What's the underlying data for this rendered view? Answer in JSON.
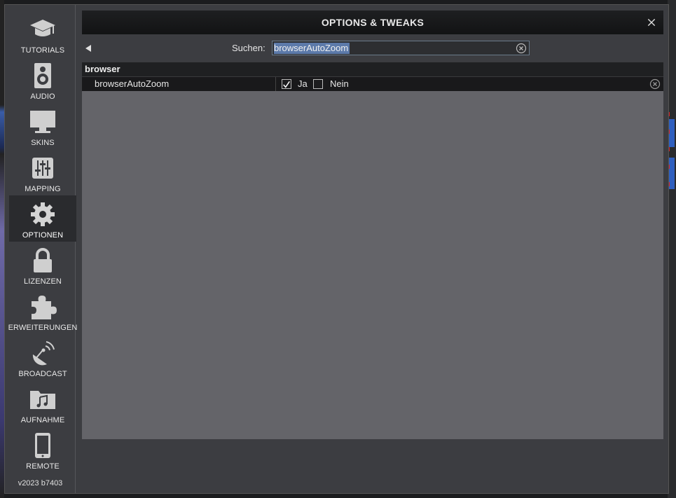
{
  "dialog": {
    "title": "OPTIONS & TWEAKS",
    "version": "v2023 b7403"
  },
  "sidebar": {
    "items": [
      {
        "label": "TUTORIALS",
        "icon": "graduation-cap-icon",
        "active": false
      },
      {
        "label": "AUDIO",
        "icon": "speaker-icon",
        "active": false
      },
      {
        "label": "SKINS",
        "icon": "monitor-icon",
        "active": false
      },
      {
        "label": "MAPPING",
        "icon": "sliders-icon",
        "active": false
      },
      {
        "label": "OPTIONEN",
        "icon": "gear-icon",
        "active": true
      },
      {
        "label": "LIZENZEN",
        "icon": "lock-icon",
        "active": false
      },
      {
        "label": "ERWEITERUNGEN",
        "icon": "puzzle-icon",
        "active": false
      },
      {
        "label": "BROADCAST",
        "icon": "satellite-dish-icon",
        "active": false
      },
      {
        "label": "AUFNAHME",
        "icon": "music-folder-icon",
        "active": false
      },
      {
        "label": "REMOTE",
        "icon": "tablet-icon",
        "active": false
      }
    ]
  },
  "search": {
    "label": "Suchen:",
    "value": "browserAutoZoom"
  },
  "options": {
    "group": "browser",
    "row": {
      "name": "browserAutoZoom",
      "yes_label": "Ja",
      "no_label": "Nein",
      "yes_checked": true,
      "no_checked": false
    }
  },
  "colors": {
    "accent_selection": "#5c7aaa",
    "panel": "#646469",
    "dialog": "#3c3d41"
  }
}
